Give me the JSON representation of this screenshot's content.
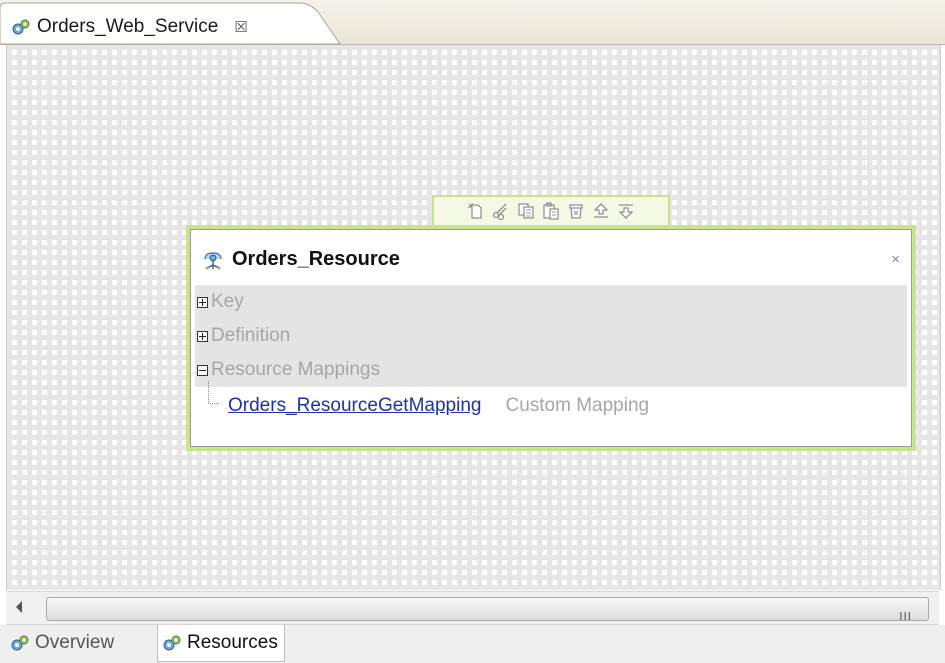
{
  "editor_tab": {
    "title": "Orders_Web_Service",
    "close_glyph": "☒",
    "icon": "web-service-icon"
  },
  "toolbar": {
    "icons": [
      "new-icon",
      "cut-icon",
      "copy-icon",
      "paste-icon",
      "delete-icon",
      "move-up-icon",
      "move-down-icon"
    ]
  },
  "resource": {
    "title": "Orders_Resource",
    "icon": "resource-icon",
    "close": "×",
    "sections": [
      {
        "label": "Key",
        "expanded": false
      },
      {
        "label": "Definition",
        "expanded": false
      },
      {
        "label": "Resource Mappings",
        "expanded": true
      }
    ],
    "mapping": {
      "name": "Orders_ResourceGetMapping",
      "type": "Custom Mapping"
    }
  },
  "scrollbar": {
    "grip": "III"
  },
  "bottom_tabs": [
    {
      "label": "Overview",
      "icon": "web-service-icon",
      "active": false
    },
    {
      "label": "Resources",
      "icon": "web-service-icon",
      "active": true
    }
  ],
  "colors": {
    "selection_border": "#c8e48f",
    "link": "#1d32a6",
    "section_bg": "#e4e4e4"
  }
}
